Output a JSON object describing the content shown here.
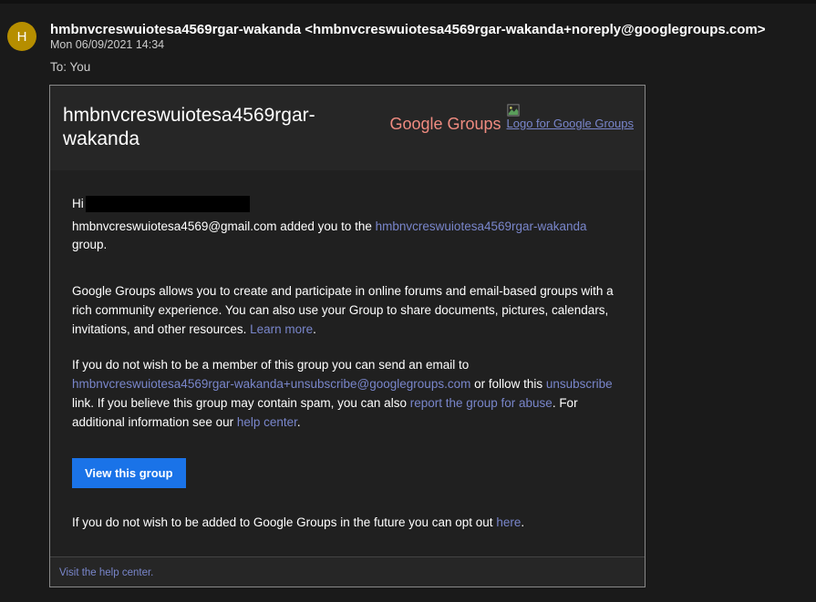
{
  "header": {
    "avatar_initial": "H",
    "from": "hmbnvcreswuiotesa4569rgar-wakanda <hmbnvcreswuiotesa4569rgar-wakanda+noreply@googlegroups.com>",
    "date": "Mon 06/09/2021 14:34",
    "to_label": "To:",
    "to_value": "You"
  },
  "card": {
    "title": "hmbnvcreswuiotesa4569rgar-wakanda",
    "brand": "Google Groups",
    "logo_alt": "Logo for Google Groups"
  },
  "body": {
    "hi": "Hi",
    "intro_1a": "hmbnvcreswuiotesa4569@gmail.com added you to the ",
    "intro_link1": "hmbnvcreswuiotesa4569rgar-wakanda",
    "intro_1b": " group.",
    "para2a": "Google Groups allows you to create and participate in online forums and email-based groups with a rich community experience. You can also use your Group to share documents, pictures, calendars, invitations, and other resources. ",
    "learn_more": "Learn more",
    "para3a": "If you do not wish to be a member of this group you can send an email to ",
    "unsub_email": "hmbnvcreswuiotesa4569rgar-wakanda+unsubscribe@googlegroups.com",
    "para3b": " or follow this ",
    "unsub_link": "unsubscribe",
    "para3c": " link. If you believe this group may contain spam, you can also ",
    "report_link": "report the group for abuse",
    "para3d": ". For additional information see our ",
    "help_center": "help center",
    "para3e": ".",
    "cta": "View this group",
    "optout_a": "If you do not wish to be added to Google Groups in the future you can opt out ",
    "optout_link": "here",
    "optout_b": "."
  },
  "footer": {
    "visit_help": "Visit the help center."
  }
}
